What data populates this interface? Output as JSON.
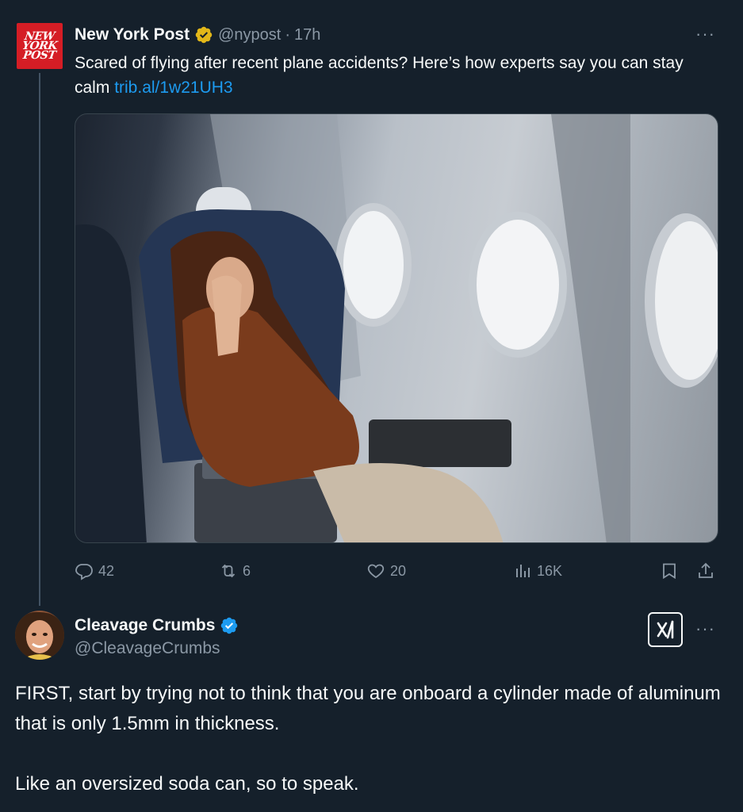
{
  "tweet": {
    "author_name": "New York Post",
    "author_handle": "@nypost",
    "time_sep": "·",
    "time": "17h",
    "avatar_text": [
      "NEW",
      "YORK",
      "POST"
    ],
    "text": "Scared of flying after recent plane accidents? Here’s how experts say you can stay calm ",
    "link": "trib.al/1w21UH3",
    "more_label": "···",
    "stats": {
      "replies": "42",
      "reposts": "6",
      "likes": "20",
      "views": "16K"
    },
    "verified_badge_color": "#e2b719"
  },
  "reply": {
    "author_name": "Cleavage Crumbs",
    "author_handle": "@CleavageCrumbs",
    "more_label": "···",
    "grok_label": "𝕏/",
    "paragraphs": [
      "FIRST, start by trying not to think that you are onboard a cylinder made of aluminum that is only 1.5mm in thickness.",
      "Like an oversized soda can, so to speak."
    ],
    "verified_badge_color": "#1d9bf0"
  },
  "icons": {
    "reply": "reply-icon",
    "repost": "repost-icon",
    "like": "heart-icon",
    "views": "views-icon",
    "bookmark": "bookmark-icon",
    "share": "share-icon"
  },
  "colors": {
    "background": "#15202b",
    "text": "#f7f9f9",
    "muted": "#8b98a5",
    "link": "#1d9bf0",
    "nyp_red": "#d51d25"
  }
}
